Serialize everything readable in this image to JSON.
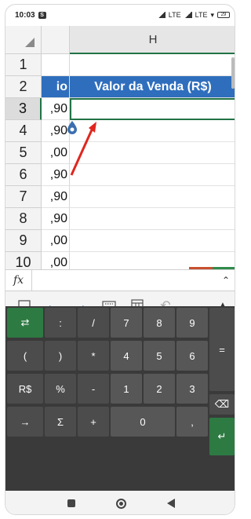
{
  "status_bar": {
    "time": "10:03",
    "notif_badge": "S",
    "network": "LTE",
    "network2": "LTE",
    "battery": "29"
  },
  "grid": {
    "column_headers": [
      "H"
    ],
    "rows": [
      {
        "num": "1",
        "g": "",
        "h": ""
      },
      {
        "num": "2",
        "g": "io",
        "h": "Valor da Venda (R$)"
      },
      {
        "num": "3",
        "g": ",90",
        "h": ""
      },
      {
        "num": "4",
        "g": ",90",
        "h": ""
      },
      {
        "num": "5",
        "g": ",00",
        "h": ""
      },
      {
        "num": "6",
        "g": ",90",
        "h": ""
      },
      {
        "num": "7",
        "g": ",90",
        "h": ""
      },
      {
        "num": "8",
        "g": ",90",
        "h": ""
      },
      {
        "num": "9",
        "g": ",00",
        "h": ""
      },
      {
        "num": "10",
        "g": ",00",
        "h": ""
      }
    ],
    "active_row": "3",
    "header_fill": "#2f6ebd",
    "accent": "#217346"
  },
  "formula_bar": {
    "fx_label": "fx",
    "value": ""
  },
  "edit_buttons": {
    "cancel": "✕",
    "accept": "✓"
  },
  "toolbar": {
    "items": [
      "screen-icon",
      "arrow-left-icon",
      "arrow-right-icon",
      "keyboard-icon",
      "calculator-icon",
      "undo-icon"
    ]
  },
  "keypad": {
    "row1": [
      "⇄",
      ":",
      "/",
      "7",
      "8",
      "9"
    ],
    "row2": [
      "(",
      ")",
      "*",
      "4",
      "5",
      "6"
    ],
    "row3": [
      "R$",
      "%",
      "-",
      "1",
      "2",
      "3"
    ],
    "row4": [
      "→",
      "Σ",
      "+",
      "0",
      ","
    ],
    "equals": "=",
    "backspace": "⌫",
    "enter": "↵"
  }
}
